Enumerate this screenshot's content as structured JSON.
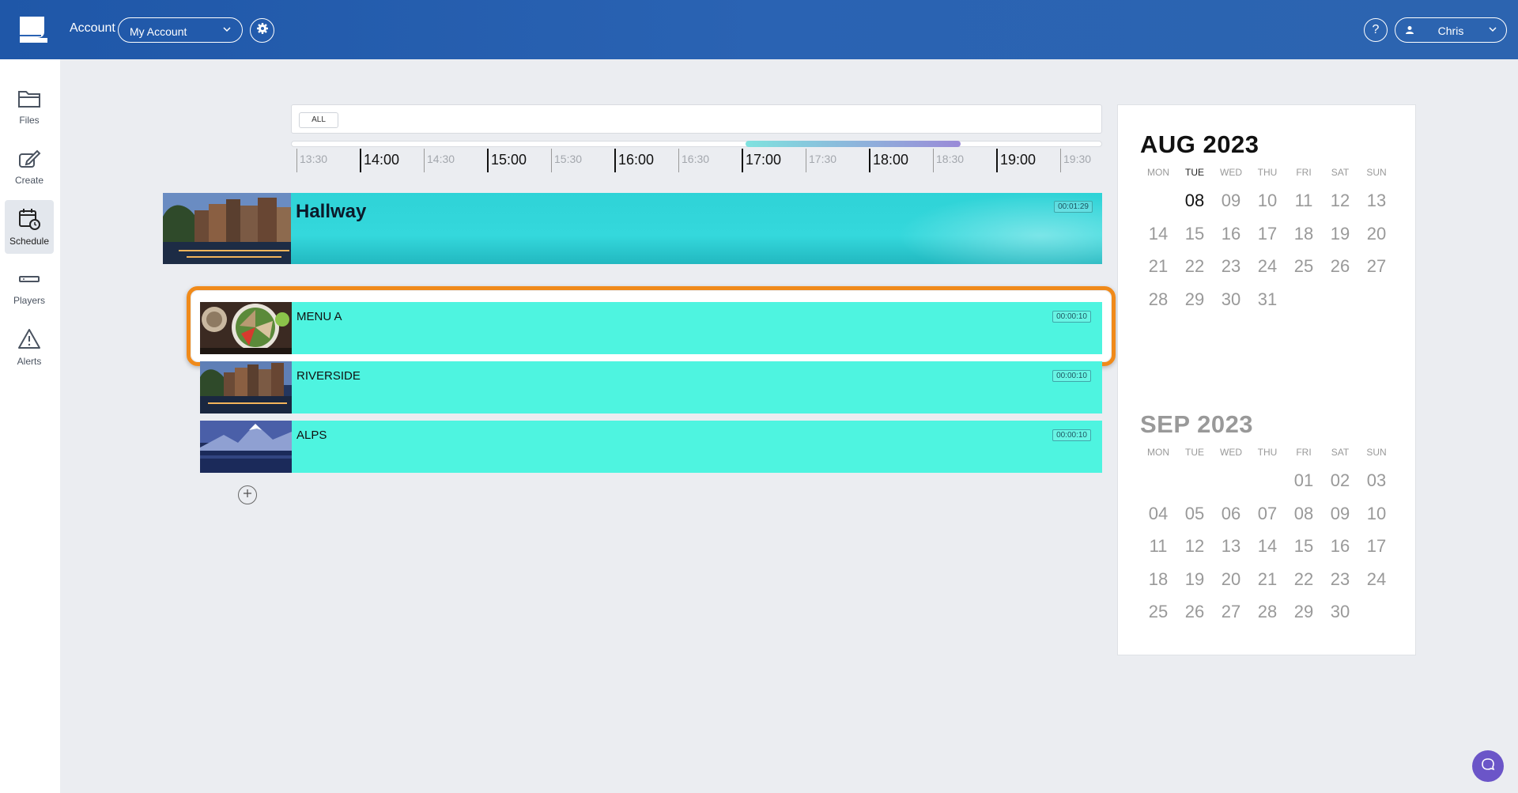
{
  "topbar": {
    "account_label": "Account",
    "account_selected": "My Account",
    "help_label": "?",
    "user_name": "Chris"
  },
  "sidebar": {
    "items": [
      {
        "label": "Files",
        "icon": "folder-icon"
      },
      {
        "label": "Create",
        "icon": "edit-icon"
      },
      {
        "label": "Schedule",
        "icon": "calendar-clock-icon",
        "active": true
      },
      {
        "label": "Players",
        "icon": "player-icon"
      },
      {
        "label": "Alerts",
        "icon": "warning-icon"
      }
    ]
  },
  "filter": {
    "chip": "ALL"
  },
  "timeline": {
    "ticks": [
      "13:30",
      "14:00",
      "14:30",
      "15:00",
      "15:30",
      "16:00",
      "16:30",
      "17:00",
      "17:30",
      "18:00",
      "18:30",
      "19:00",
      "19:30"
    ]
  },
  "schedule": {
    "channel": {
      "title": "Hallway",
      "duration": "00:01:29"
    },
    "items": [
      {
        "label": "MENU A",
        "duration": "00:00:10"
      },
      {
        "label": "RIVERSIDE",
        "duration": "00:00:10"
      },
      {
        "label": "ALPS",
        "duration": "00:00:10"
      }
    ]
  },
  "calendar": {
    "weekdays": [
      "MON",
      "TUE",
      "WED",
      "THU",
      "FRI",
      "SAT",
      "SUN"
    ],
    "aug": {
      "title": "AUG 2023",
      "days": [
        "",
        "08",
        "09",
        "10",
        "11",
        "12",
        "13",
        "14",
        "15",
        "16",
        "17",
        "18",
        "19",
        "20",
        "21",
        "22",
        "23",
        "24",
        "25",
        "26",
        "27",
        "28",
        "29",
        "30",
        "31"
      ],
      "today": "08"
    },
    "sep": {
      "title": "SEP 2023",
      "days": [
        "",
        "",
        "",
        "",
        "01",
        "02",
        "03",
        "04",
        "05",
        "06",
        "07",
        "08",
        "09",
        "10",
        "11",
        "12",
        "13",
        "14",
        "15",
        "16",
        "17",
        "18",
        "19",
        "20",
        "21",
        "22",
        "23",
        "24",
        "25",
        "26",
        "27",
        "28",
        "29",
        "30"
      ]
    }
  },
  "colors": {
    "topbar": "#2a63b3",
    "item_bg": "#4ef4e0",
    "highlight": "#f08a1a",
    "chat": "#6b55c8"
  }
}
